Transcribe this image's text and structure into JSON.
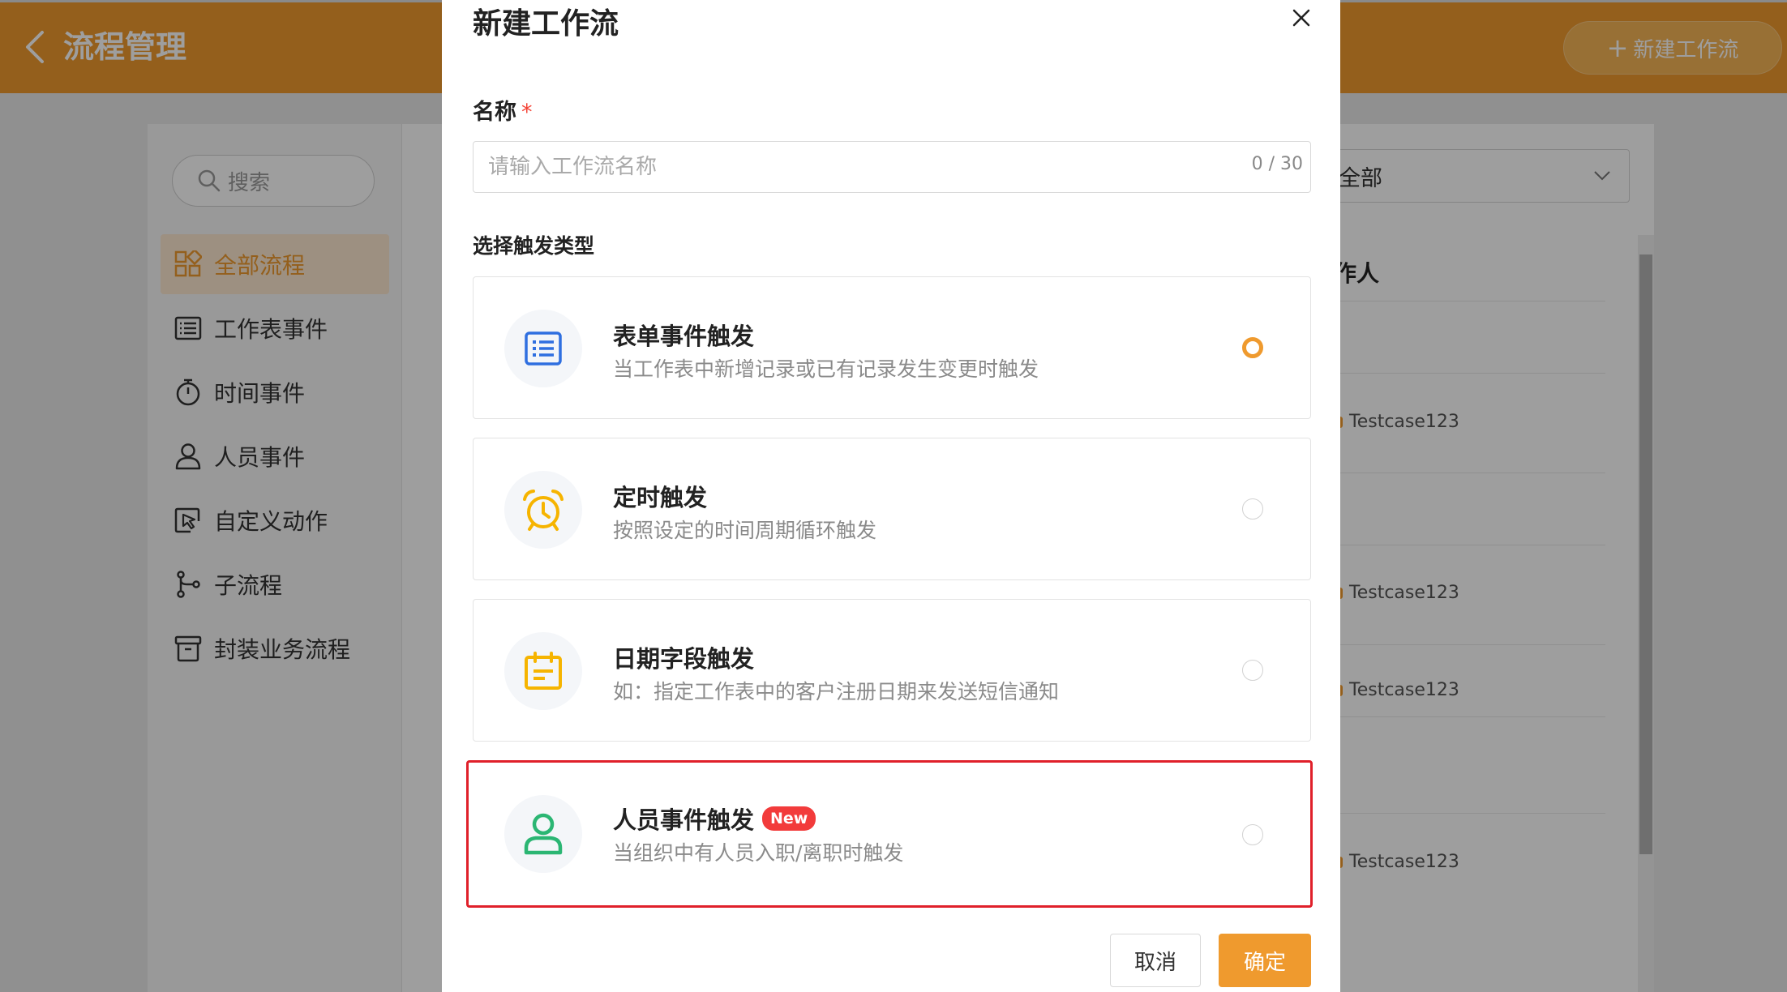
{
  "header": {
    "title": "流程管理",
    "new_button_label": "新建工作流",
    "new_button_plus": "+"
  },
  "sidebar": {
    "search_placeholder": "搜索",
    "items": [
      {
        "label": "全部流程",
        "icon": "grid-icon",
        "active": true
      },
      {
        "label": "工作表事件",
        "icon": "list-icon"
      },
      {
        "label": "时间事件",
        "icon": "stopwatch-icon"
      },
      {
        "label": "人员事件",
        "icon": "person-icon"
      },
      {
        "label": "自定义动作",
        "icon": "cursor-box-icon"
      },
      {
        "label": "子流程",
        "icon": "branch-icon"
      },
      {
        "label": "封装业务流程",
        "icon": "archive-icon"
      }
    ]
  },
  "list": {
    "filter_value": "全部",
    "column_header": "作人",
    "rows": [
      "Testcase123",
      "Testcase123",
      "Testcase123",
      "Testcase123"
    ]
  },
  "modal": {
    "title": "新建工作流",
    "name_label": "名称",
    "required_mark": "*",
    "name_placeholder": "请输入工作流名称",
    "name_counter": "0 / 30",
    "trigger_section_label": "选择触发类型",
    "triggers": [
      {
        "title": "表单事件触发",
        "desc": "当工作表中新增记录或已有记录发生变更时触发",
        "icon": "form-list-icon",
        "checked": true
      },
      {
        "title": "定时触发",
        "desc": "按照设定的时间周期循环触发",
        "icon": "alarm-clock-icon",
        "checked": false
      },
      {
        "title": "日期字段触发",
        "desc": "如：指定工作表中的客户注册日期来发送短信通知",
        "icon": "calendar-icon",
        "checked": false
      },
      {
        "title": "人员事件触发",
        "desc": "当组织中有人员入职/离职时触发",
        "icon": "person-icon",
        "checked": false,
        "badge": "New"
      }
    ],
    "cancel_label": "取消",
    "ok_label": "确定"
  },
  "colors": {
    "accent": "#ef9a2e",
    "highlight_border": "#e0202a",
    "badge": "#f23b3b"
  }
}
